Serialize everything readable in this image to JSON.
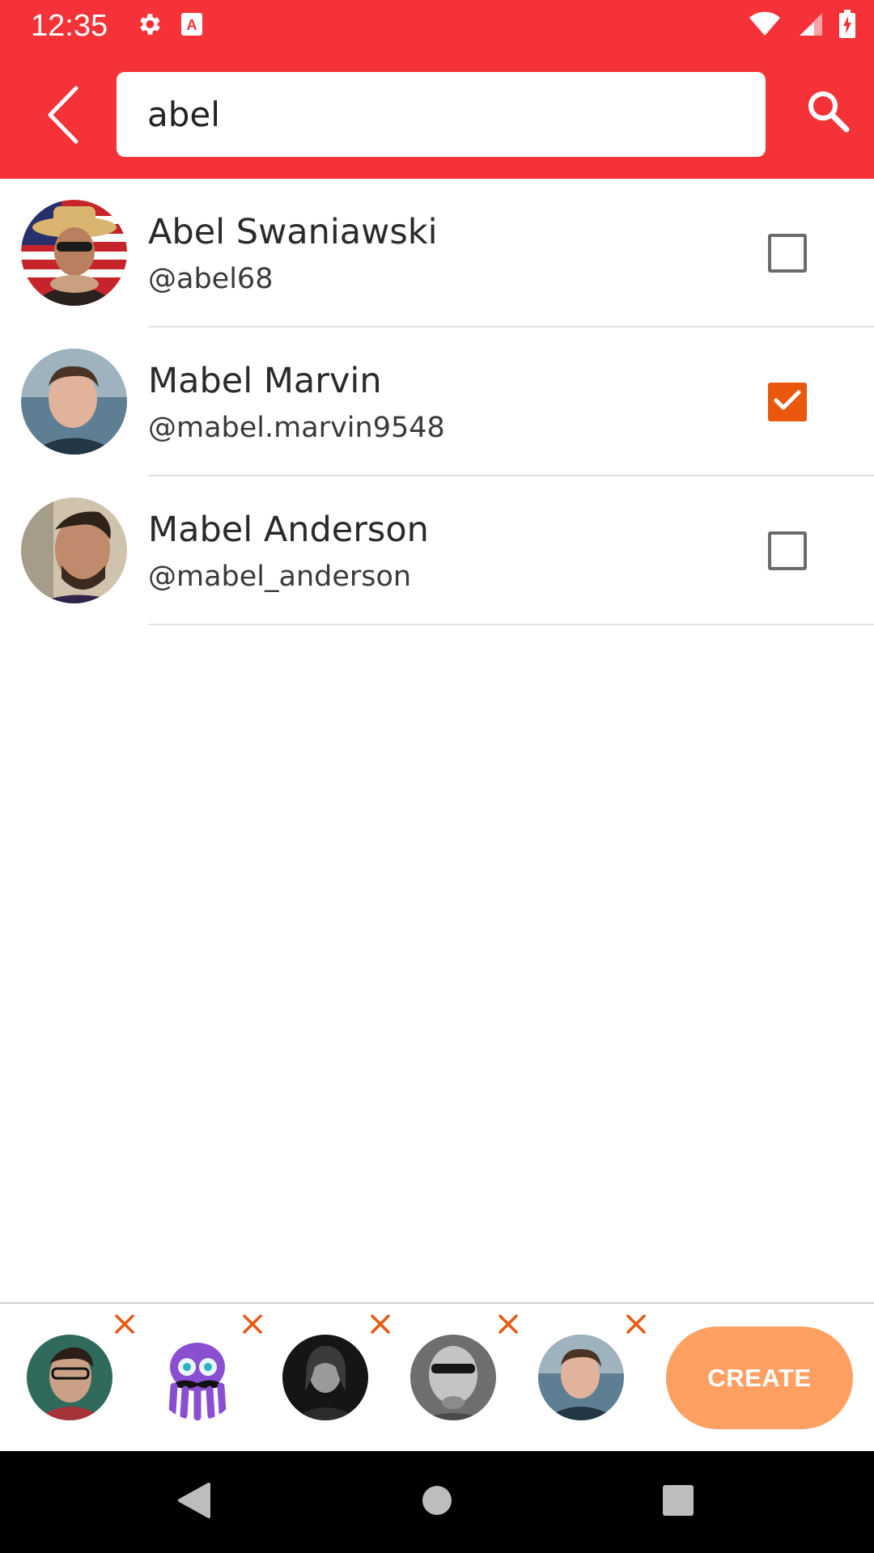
{
  "status_bar": {
    "time": "12:35",
    "icons_left": [
      "gear-icon",
      "a-notification-icon"
    ],
    "icons_right": [
      "wifi-icon",
      "signal-icon",
      "battery-charging-icon"
    ]
  },
  "header": {
    "back_icon": "chevron-left-icon",
    "search_value": "abel",
    "search_icon": "search-icon",
    "background_color": "#f53238"
  },
  "results": [
    {
      "name": "Abel Swaniawski",
      "handle": "@abel68",
      "checked": false
    },
    {
      "name": "Mabel Marvin",
      "handle": "@mabel.marvin9548",
      "checked": true
    },
    {
      "name": "Mabel Anderson",
      "handle": "@mabel_anderson",
      "checked": false
    }
  ],
  "selected_tray": {
    "chip_count": 5,
    "remove_icon": "close-icon",
    "create_label": "CREATE",
    "create_color": "#ffa062"
  },
  "nav_bar": {
    "icons": [
      "back-triangle-icon",
      "home-circle-icon",
      "recents-square-icon"
    ]
  },
  "accent_color": "#e9580c"
}
